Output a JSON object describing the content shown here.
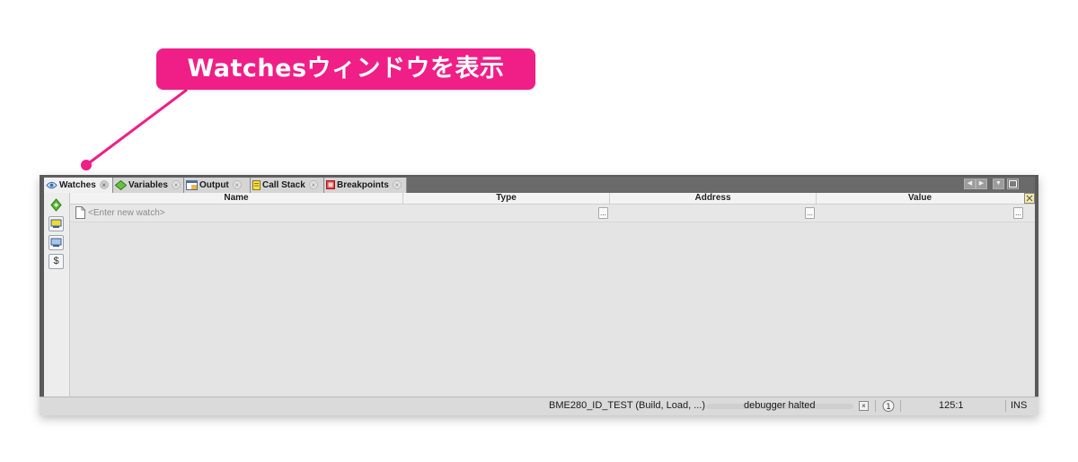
{
  "callout": {
    "text": "Watchesウィンドウを表示",
    "color": "#f01e87"
  },
  "tabs": [
    {
      "label": "Watches",
      "icon": "watches-icon",
      "active": true
    },
    {
      "label": "Variables",
      "icon": "variables-icon",
      "active": false
    },
    {
      "label": "Output",
      "icon": "output-icon",
      "active": false
    },
    {
      "label": "Call Stack",
      "icon": "call-stack-icon",
      "active": false
    },
    {
      "label": "Breakpoints",
      "icon": "breakpoints-icon",
      "active": false
    }
  ],
  "table": {
    "columns": [
      "Name",
      "Type",
      "Address",
      "Value"
    ],
    "new_watch_placeholder": "<Enter new watch>",
    "ellipsis": "..."
  },
  "toolbar": {
    "buttons": [
      "new-watch-icon",
      "watch-settings-icon",
      "watch-memory-icon",
      "watch-symbol-icon"
    ]
  },
  "status": {
    "project": "BME280_ID_TEST (Build, Load, ...)",
    "state": "debugger halted",
    "position": "125:1",
    "mode": "INS"
  }
}
